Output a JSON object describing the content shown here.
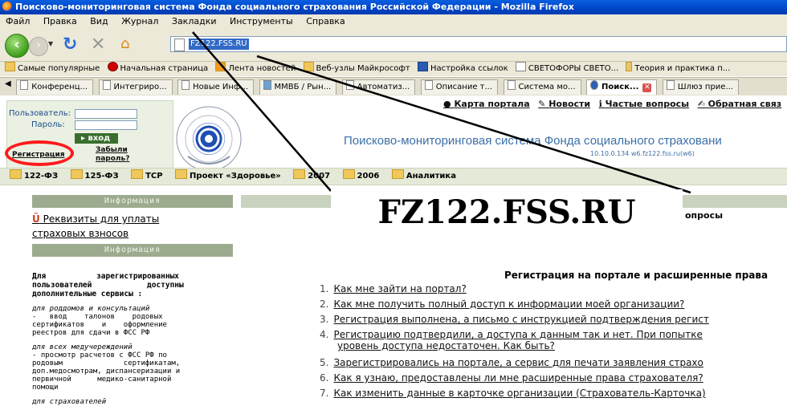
{
  "window": {
    "title": "Поисково-мониторинговая система Фонда социального страхования Российской Федерации - Mozilla Firefox"
  },
  "menu": [
    "Файл",
    "Правка",
    "Вид",
    "Журнал",
    "Закладки",
    "Инструменты",
    "Справка"
  ],
  "nav": {
    "url": "FZ122.FSS.RU"
  },
  "bookmarks": [
    "Самые популярные",
    "Начальная страница",
    "Лента новостей",
    "Веб-узлы Майкрософт",
    "Настройка ссылок",
    "СВЕТОФОРЫ СВЕТО...",
    "Теория и практика п..."
  ],
  "tabs": [
    {
      "label": "Конференц...",
      "active": false
    },
    {
      "label": "Интегриро...",
      "active": false
    },
    {
      "label": "Новые Инф...",
      "active": false
    },
    {
      "label": "ММВБ / Рын...",
      "active": false
    },
    {
      "label": "Автоматиз...",
      "active": false
    },
    {
      "label": "Описание т...",
      "active": false
    },
    {
      "label": "Система мо...",
      "active": false
    },
    {
      "label": "Поиск...",
      "active": true
    },
    {
      "label": "Шлюз прие...",
      "active": false
    }
  ],
  "login": {
    "user_label": "Пользователь:",
    "password_label": "Пароль:",
    "login_button": "вход",
    "register_link": "Регистрация",
    "forgot_link_1": "Забыли",
    "forgot_link_2": "пароль?"
  },
  "top_links": [
    "Карта портала",
    "Новости",
    "Частые вопросы",
    "Обратная связ"
  ],
  "site": {
    "title": "Поисково-мониторинговая система Фонда социального страховани",
    "subtitle": "10.10.0.134  w6.fz122.fss.ru(w6)"
  },
  "sections": [
    "122-ФЗ",
    "125-ФЗ",
    "ТСР",
    "Проект «Здоровье»",
    "2007",
    "2006",
    "Аналитика"
  ],
  "left": {
    "info_header_1": "Информация",
    "rekvizity": "Реквизиты для уплаты",
    "rekvizity_2": "страховых взносов",
    "info_header_2": "Информация",
    "intro_1": "Для           зарегистрированных",
    "intro_2": "пользователей            доступны",
    "intro_3": "дополнительные сервисы :",
    "group1_title": "для роддомов и консультаций",
    "group1_l1": "-   ввод    талонов    родовых",
    "group1_l2": "сертификатов    и    оформление",
    "group1_l3": "реестров для сдачи в ФСС РФ",
    "group2_title": "для всех медучереждений",
    "group2_l1": "- просмотр расчетов с ФСС РФ по",
    "group2_l2": "родовым              сертификатам,",
    "group2_l3": "доп.медосмотрам, диспансеризации и",
    "group2_l4": "первичной      медико-санитарной",
    "group2_l5": "помощи",
    "group3_title": "для страхователей"
  },
  "callout": {
    "text": "FZ122.FSS.RU"
  },
  "right_ghost": "опросы",
  "faq": {
    "title": "Регистрация на портале и расширенные права",
    "items": [
      {
        "n": "1.",
        "text": "Как мне зайти на портал?"
      },
      {
        "n": "2.",
        "text": "Как мне получить полный доступ к информации моей организации?"
      },
      {
        "n": "3.",
        "text": "Регистрация выполнена, а письмо с инструкцией подтверждения регист"
      },
      {
        "n": "4.",
        "text": "Регистрацию подтвердили, а доступа к данным так и нет. При попытке"
      },
      {
        "n": "",
        "text": "уровень доступа недостаточен. Как быть?"
      },
      {
        "n": "5.",
        "text": "Зарегистрировались на портале, а сервис для печати заявления страхо"
      },
      {
        "n": "6.",
        "text": "Как я узнаю, предоставлены ли мне расширенные права страхователя?"
      },
      {
        "n": "7.",
        "text": "Как изменить данные в карточке организации (Страхователь-Карточка)"
      }
    ]
  }
}
